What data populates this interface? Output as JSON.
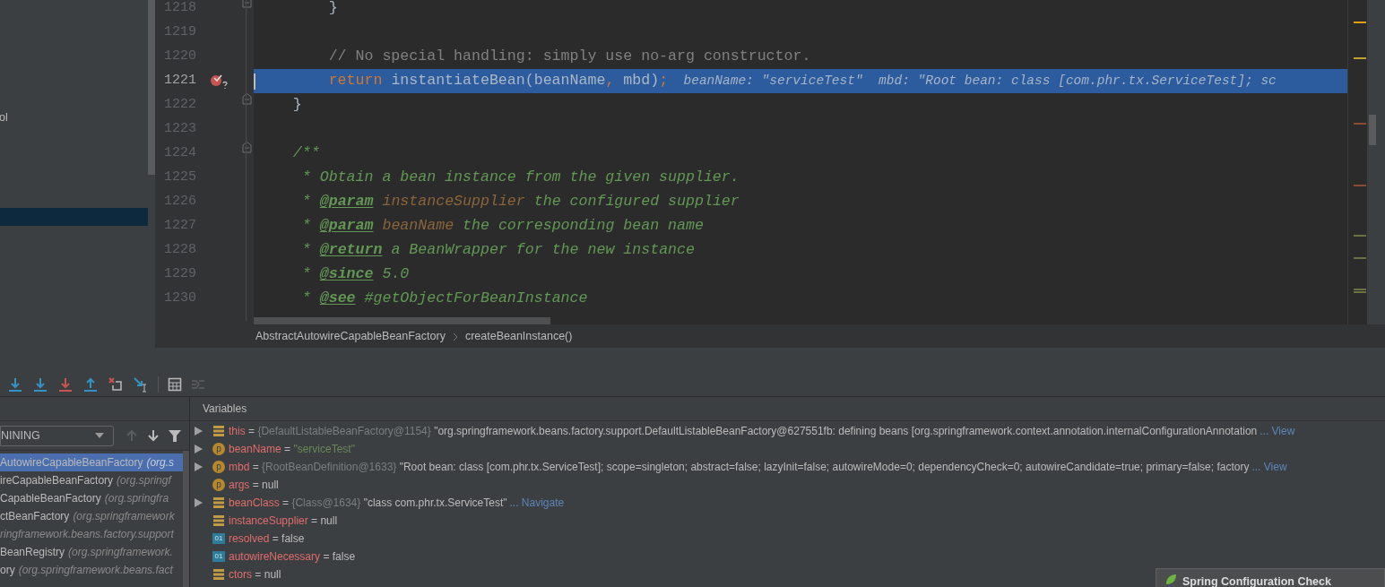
{
  "project_panel": {
    "items": [
      {
        "label": "ol",
        "selected": false
      },
      {
        "selected": true
      }
    ]
  },
  "editor": {
    "lines": [
      {
        "number": "1218",
        "fold": true,
        "segments": [
          {
            "kind": "plain",
            "text": "        }"
          }
        ]
      },
      {
        "number": "1219"
      },
      {
        "number": "1220",
        "segments": [
          {
            "kind": "comment",
            "text": "        // No special handling: simply use no-arg constructor."
          }
        ]
      },
      {
        "number": "1221",
        "selected": true,
        "breakpoint": true,
        "segments": [
          {
            "kind": "keyword",
            "text": "        return "
          },
          {
            "kind": "plain",
            "text": "instantiateBean(beanName"
          },
          {
            "kind": "keyword",
            "text": ", "
          },
          {
            "kind": "plain",
            "text": "mbd)"
          },
          {
            "kind": "keyword",
            "text": ";"
          },
          {
            "kind": "hint",
            "text": "  beanName: \"serviceTest\"  mbd: \"Root bean: class [com.phr.tx.ServiceTest]; sc"
          }
        ]
      },
      {
        "number": "1222",
        "fold": true,
        "segments": [
          {
            "kind": "plain",
            "text": "    }"
          }
        ]
      },
      {
        "number": "1223"
      },
      {
        "number": "1224",
        "fold": true,
        "segments": [
          {
            "kind": "doc",
            "text": "    /**"
          }
        ]
      },
      {
        "number": "1225",
        "segments": [
          {
            "kind": "doc",
            "text": "     * Obtain a bean instance from the given supplier."
          }
        ]
      },
      {
        "number": "1226",
        "segments": [
          {
            "kind": "doc",
            "text": "     * "
          },
          {
            "kind": "doctag",
            "text": "@param"
          },
          {
            "kind": "docparam",
            "text": " instanceSupplier"
          },
          {
            "kind": "doc",
            "text": " the configured supplier"
          }
        ]
      },
      {
        "number": "1227",
        "segments": [
          {
            "kind": "doc",
            "text": "     * "
          },
          {
            "kind": "doctag",
            "text": "@param"
          },
          {
            "kind": "docparam",
            "text": " beanName"
          },
          {
            "kind": "doc",
            "text": " the corresponding bean name"
          }
        ]
      },
      {
        "number": "1228",
        "segments": [
          {
            "kind": "doc",
            "text": "     * "
          },
          {
            "kind": "doctag",
            "text": "@return"
          },
          {
            "kind": "doc",
            "text": " a BeanWrapper for the new instance"
          }
        ]
      },
      {
        "number": "1229",
        "segments": [
          {
            "kind": "doc",
            "text": "     * "
          },
          {
            "kind": "doctag",
            "text": "@since"
          },
          {
            "kind": "doc",
            "text": " 5.0"
          }
        ]
      },
      {
        "number": "1230",
        "segments": [
          {
            "kind": "doc",
            "text": "     * "
          },
          {
            "kind": "doctag",
            "text": "@see"
          },
          {
            "kind": "doc",
            "text": " #getObjectForBeanInstance"
          }
        ]
      }
    ],
    "breadcrumbs": [
      "AbstractAutowireCapableBeanFactory",
      "createBeanInstance()"
    ]
  },
  "debugger": {
    "thread_filter": "NINING",
    "frames": [
      {
        "method": "AutowireCapableBeanFactory",
        "package": "(org.s",
        "selected": true
      },
      {
        "method": "ireCapableBeanFactory",
        "package": "(org.springf",
        "selected": false
      },
      {
        "method": "CapableBeanFactory",
        "package": "(org.springfra",
        "selected": false
      },
      {
        "method": "ctBeanFactory",
        "package": "(org.springframework",
        "selected": false
      },
      {
        "package": "ringframework.beans.factory.support",
        "selected": false
      },
      {
        "method": "BeanRegistry",
        "package": "(org.springframework.",
        "selected": false
      },
      {
        "method": "ory",
        "package": "(org.springframework.beans.fact",
        "selected": false
      }
    ],
    "variables": {
      "title": "Variables",
      "items": [
        {
          "expandable": true,
          "kind": "field",
          "name": "this",
          "operator": "=",
          "ref": "{DefaultListableBeanFactory@1154}",
          "value": "\"org.springframework.beans.factory.support.DefaultListableBeanFactory@627551fb: defining beans [org.springframework.context.annotation.internalConfigurationAnnotation",
          "is_string": false,
          "link": "... View"
        },
        {
          "expandable": true,
          "kind": "param",
          "icon_label": "p",
          "name": "beanName",
          "operator": "=",
          "value": "\"serviceTest\"",
          "is_string": true
        },
        {
          "expandable": true,
          "kind": "param",
          "icon_label": "p",
          "name": "mbd",
          "operator": "=",
          "ref": "{RootBeanDefinition@1633}",
          "value": "\"Root bean: class [com.phr.tx.ServiceTest]; scope=singleton; abstract=false; lazyInit=false; autowireMode=0; dependencyCheck=0; autowireCandidate=true; primary=false; factory",
          "is_string": false,
          "link": "... View"
        },
        {
          "expandable": false,
          "kind": "param",
          "icon_label": "p",
          "name": "args",
          "operator": "=",
          "value": "null",
          "is_string": false
        },
        {
          "expandable": true,
          "kind": "field",
          "name": "beanClass",
          "operator": "=",
          "ref": "{Class@1634}",
          "value": "\"class com.phr.tx.ServiceTest\"",
          "is_string": false,
          "link": "... Navigate"
        },
        {
          "expandable": false,
          "kind": "field",
          "name": "instanceSupplier",
          "operator": "=",
          "value": "null",
          "is_string": false
        },
        {
          "expandable": false,
          "kind": "primitive",
          "icon_label": "01",
          "name": "resolved",
          "operator": "=",
          "value": "false",
          "is_string": false
        },
        {
          "expandable": false,
          "kind": "primitive",
          "icon_label": "01",
          "name": "autowireNecessary",
          "operator": "=",
          "value": "false",
          "is_string": false
        },
        {
          "expandable": false,
          "kind": "field",
          "name": "ctors",
          "operator": "=",
          "value": "null",
          "is_string": false
        }
      ]
    }
  },
  "notification": {
    "title": "Spring Configuration Check"
  }
}
